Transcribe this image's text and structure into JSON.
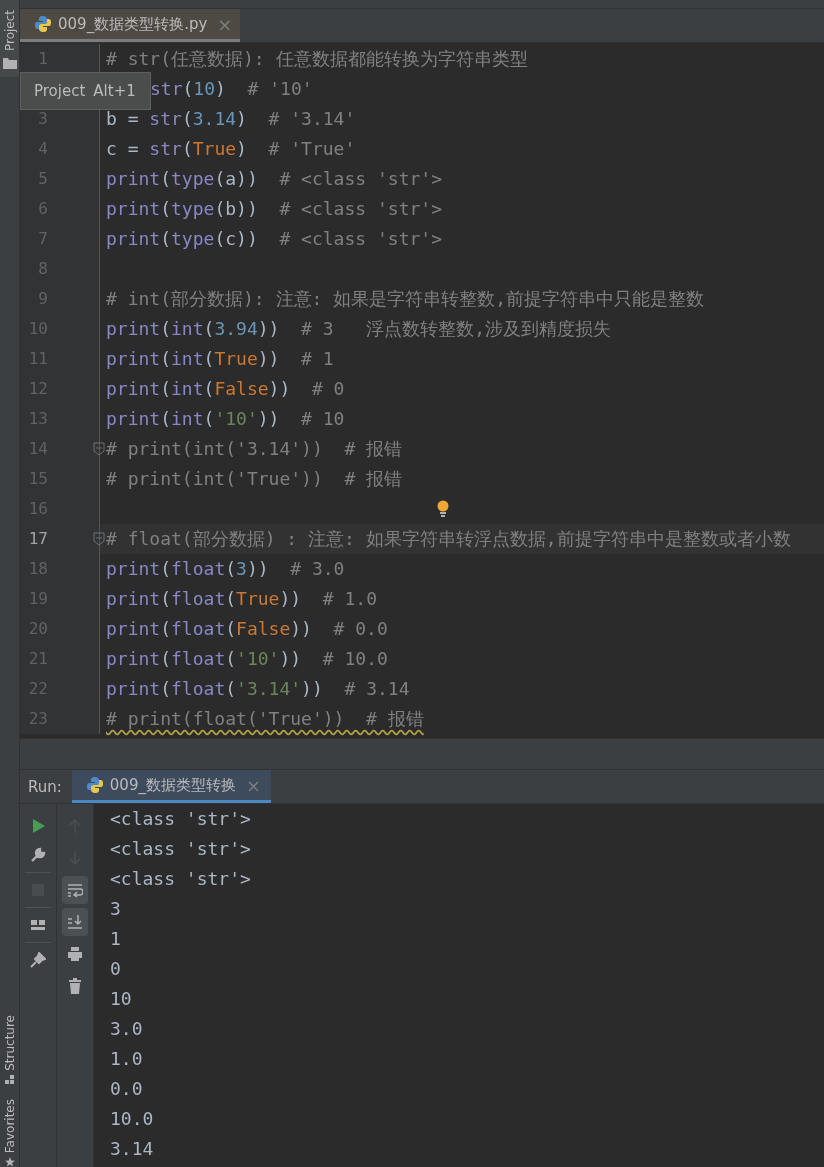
{
  "left_stripe": {
    "top": [
      {
        "label": "Project"
      }
    ],
    "bottom": [
      {
        "label": "Structure",
        "kind": "structure"
      },
      {
        "label": "Favorites",
        "kind": "star"
      }
    ]
  },
  "tooltip": {
    "title": "Project",
    "shortcut": "Alt+1"
  },
  "editor_tabs": [
    {
      "label": "009_数据类型转换.py",
      "selected": true,
      "close": "×"
    }
  ],
  "code_lines": [
    {
      "number": "1",
      "tokens": [
        {
          "kind": "comment",
          "text": "# str(任意数据): 任意数据都能转换为字符串类型"
        }
      ]
    },
    {
      "covered": true,
      "tokens": [
        {
          "kind": "builtin",
          "text": "str"
        },
        {
          "kind": "plain",
          "text": "("
        },
        {
          "kind": "number",
          "text": "10"
        },
        {
          "kind": "plain",
          "text": ")"
        },
        {
          "kind": "comment",
          "text": "  # '10'"
        }
      ]
    },
    {
      "number": "3",
      "tokens": [
        {
          "kind": "plain",
          "text": "b = "
        },
        {
          "kind": "builtin",
          "text": "str"
        },
        {
          "kind": "plain",
          "text": "("
        },
        {
          "kind": "number",
          "text": "3.14"
        },
        {
          "kind": "plain",
          "text": ")"
        },
        {
          "kind": "comment",
          "text": "  # '3.14'"
        }
      ]
    },
    {
      "number": "4",
      "tokens": [
        {
          "kind": "plain",
          "text": "c = "
        },
        {
          "kind": "builtin",
          "text": "str"
        },
        {
          "kind": "plain",
          "text": "("
        },
        {
          "kind": "keyword",
          "text": "True"
        },
        {
          "kind": "plain",
          "text": ")"
        },
        {
          "kind": "comment",
          "text": "  # 'True'"
        }
      ]
    },
    {
      "number": "5",
      "tokens": [
        {
          "kind": "builtin",
          "text": "print"
        },
        {
          "kind": "plain",
          "text": "("
        },
        {
          "kind": "builtin",
          "text": "type"
        },
        {
          "kind": "plain",
          "text": "(a))"
        },
        {
          "kind": "comment",
          "text": "  # <class 'str'>"
        }
      ]
    },
    {
      "number": "6",
      "tokens": [
        {
          "kind": "builtin",
          "text": "print"
        },
        {
          "kind": "plain",
          "text": "("
        },
        {
          "kind": "builtin",
          "text": "type"
        },
        {
          "kind": "plain",
          "text": "(b))"
        },
        {
          "kind": "comment",
          "text": "  # <class 'str'>"
        }
      ]
    },
    {
      "number": "7",
      "tokens": [
        {
          "kind": "builtin",
          "text": "print"
        },
        {
          "kind": "plain",
          "text": "("
        },
        {
          "kind": "builtin",
          "text": "type"
        },
        {
          "kind": "plain",
          "text": "(c))"
        },
        {
          "kind": "comment",
          "text": "  # <class 'str'>"
        }
      ]
    },
    {
      "number": "8"
    },
    {
      "number": "9",
      "tokens": [
        {
          "kind": "comment",
          "text": "# int(部分数据): 注意: 如果是字符串转整数,前提字符串中只能是整数"
        }
      ]
    },
    {
      "number": "10",
      "tokens": [
        {
          "kind": "builtin",
          "text": "print"
        },
        {
          "kind": "plain",
          "text": "("
        },
        {
          "kind": "builtin",
          "text": "int"
        },
        {
          "kind": "plain",
          "text": "("
        },
        {
          "kind": "number",
          "text": "3.94"
        },
        {
          "kind": "plain",
          "text": "))"
        },
        {
          "kind": "comment",
          "text": "  # 3   浮点数转整数,涉及到精度损失"
        }
      ]
    },
    {
      "number": "11",
      "tokens": [
        {
          "kind": "builtin",
          "text": "print"
        },
        {
          "kind": "plain",
          "text": "("
        },
        {
          "kind": "builtin",
          "text": "int"
        },
        {
          "kind": "plain",
          "text": "("
        },
        {
          "kind": "keyword",
          "text": "True"
        },
        {
          "kind": "plain",
          "text": "))"
        },
        {
          "kind": "comment",
          "text": "  # 1"
        }
      ]
    },
    {
      "number": "12",
      "tokens": [
        {
          "kind": "builtin",
          "text": "print"
        },
        {
          "kind": "plain",
          "text": "("
        },
        {
          "kind": "builtin",
          "text": "int"
        },
        {
          "kind": "plain",
          "text": "("
        },
        {
          "kind": "keyword",
          "text": "False"
        },
        {
          "kind": "plain",
          "text": "))"
        },
        {
          "kind": "comment",
          "text": "  # 0"
        }
      ]
    },
    {
      "number": "13",
      "tokens": [
        {
          "kind": "builtin",
          "text": "print"
        },
        {
          "kind": "plain",
          "text": "("
        },
        {
          "kind": "builtin",
          "text": "int"
        },
        {
          "kind": "plain",
          "text": "("
        },
        {
          "kind": "string",
          "text": "'10'"
        },
        {
          "kind": "plain",
          "text": "))"
        },
        {
          "kind": "comment",
          "text": "  # 10"
        }
      ]
    },
    {
      "number": "14",
      "fold": true,
      "tokens": [
        {
          "kind": "comment",
          "text": "# print(int('3.14'))  # 报错"
        }
      ]
    },
    {
      "number": "15",
      "tokens": [
        {
          "kind": "comment",
          "text": "# print(int('True'))  # 报错"
        }
      ]
    },
    {
      "number": "16",
      "bulb": true
    },
    {
      "number": "17",
      "fold": true,
      "current": true,
      "tokens": [
        {
          "kind": "comment",
          "text": "# float(部分数据) : 注意: 如果字符串转浮点数据,前提字符串中是整数或者小数"
        }
      ]
    },
    {
      "number": "18",
      "tokens": [
        {
          "kind": "builtin",
          "text": "print"
        },
        {
          "kind": "plain",
          "text": "("
        },
        {
          "kind": "builtin",
          "text": "float"
        },
        {
          "kind": "plain",
          "text": "("
        },
        {
          "kind": "number",
          "text": "3"
        },
        {
          "kind": "plain",
          "text": "))"
        },
        {
          "kind": "comment",
          "text": "  # 3.0"
        }
      ]
    },
    {
      "number": "19",
      "tokens": [
        {
          "kind": "builtin",
          "text": "print"
        },
        {
          "kind": "plain",
          "text": "("
        },
        {
          "kind": "builtin",
          "text": "float"
        },
        {
          "kind": "plain",
          "text": "("
        },
        {
          "kind": "keyword",
          "text": "True"
        },
        {
          "kind": "plain",
          "text": "))"
        },
        {
          "kind": "comment",
          "text": "  # 1.0"
        }
      ]
    },
    {
      "number": "20",
      "tokens": [
        {
          "kind": "builtin",
          "text": "print"
        },
        {
          "kind": "plain",
          "text": "("
        },
        {
          "kind": "builtin",
          "text": "float"
        },
        {
          "kind": "plain",
          "text": "("
        },
        {
          "kind": "keyword",
          "text": "False"
        },
        {
          "kind": "plain",
          "text": "))"
        },
        {
          "kind": "comment",
          "text": "  # 0.0"
        }
      ]
    },
    {
      "number": "21",
      "tokens": [
        {
          "kind": "builtin",
          "text": "print"
        },
        {
          "kind": "plain",
          "text": "("
        },
        {
          "kind": "builtin",
          "text": "float"
        },
        {
          "kind": "plain",
          "text": "("
        },
        {
          "kind": "string",
          "text": "'10'"
        },
        {
          "kind": "plain",
          "text": "))"
        },
        {
          "kind": "comment",
          "text": "  # 10.0"
        }
      ]
    },
    {
      "number": "22",
      "tokens": [
        {
          "kind": "builtin",
          "text": "print"
        },
        {
          "kind": "plain",
          "text": "("
        },
        {
          "kind": "builtin",
          "text": "float"
        },
        {
          "kind": "plain",
          "text": "("
        },
        {
          "kind": "string",
          "text": "'3.14'"
        },
        {
          "kind": "plain",
          "text": "))"
        },
        {
          "kind": "comment",
          "text": "  # 3.14"
        }
      ]
    },
    {
      "number": "23",
      "warning": true,
      "tokens": [
        {
          "kind": "comment",
          "text": "# print(float('True'))  # 报错"
        }
      ]
    }
  ],
  "run_panel": {
    "label": "Run:",
    "tabs": [
      {
        "label": "009_数据类型转换",
        "selected": true,
        "close": "×"
      }
    ],
    "toolbar_1": [
      {
        "kind": "play",
        "disabled": false
      },
      {
        "kind": "wrench",
        "disabled": false
      },
      {
        "kind": "separator"
      },
      {
        "kind": "stop",
        "disabled": true
      },
      {
        "kind": "separator"
      },
      {
        "kind": "layout",
        "disabled": false
      },
      {
        "kind": "separator"
      },
      {
        "kind": "pin",
        "disabled": false
      }
    ],
    "toolbar_2": [
      {
        "kind": "up",
        "disabled": true,
        "on": false
      },
      {
        "kind": "down",
        "disabled": true,
        "on": false
      },
      {
        "kind": "wrap",
        "disabled": false,
        "on": true
      },
      {
        "kind": "scroll_end",
        "disabled": false,
        "on": true
      },
      {
        "kind": "print",
        "disabled": false,
        "on": false
      },
      {
        "kind": "trash",
        "disabled": false,
        "on": false
      }
    ],
    "output": [
      "<class 'str'>",
      "<class 'str'>",
      "<class 'str'>",
      "3",
      "1",
      "0",
      "10",
      "3.0",
      "1.0",
      "0.0",
      "10.0",
      "3.14"
    ]
  }
}
